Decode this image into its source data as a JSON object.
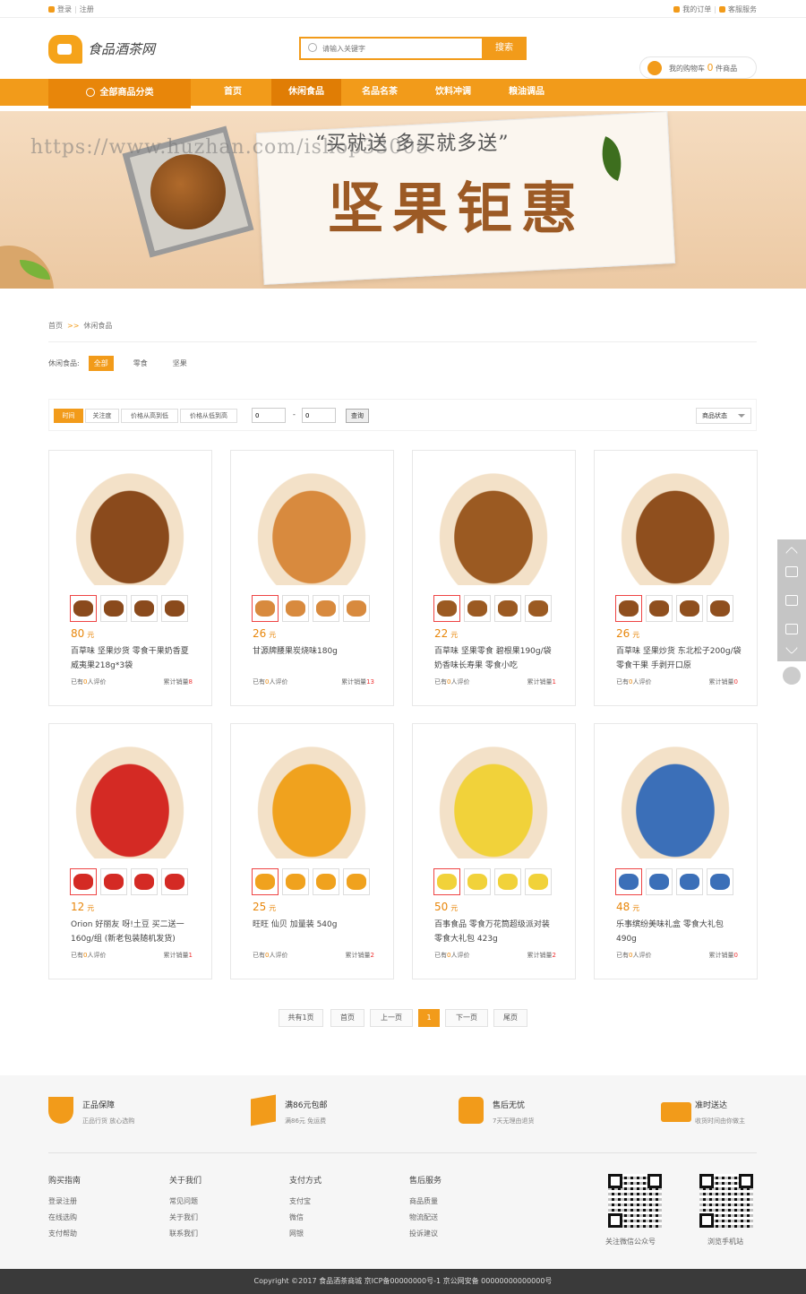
{
  "topbar": {
    "login": "登录",
    "register": "注册",
    "orders": "我的订单",
    "service": "客服服务"
  },
  "header": {
    "logo_text": "食品酒茶网",
    "search_placeholder": "请输入关键字",
    "search_button": "搜索",
    "cart_prefix": "我的购物车",
    "cart_count": "0",
    "cart_suffix": "件商品"
  },
  "nav": {
    "all": "全部商品分类",
    "items": [
      "首页",
      "休闲食品",
      "名品名茶",
      "饮料冲调",
      "粮油调品"
    ],
    "active": 1
  },
  "banner": {
    "watermark": "https://www.huzhan.com/ishop33008",
    "subtitle": "“买就送 多买就多送”",
    "title": "坚果钜惠"
  },
  "breadcrumb": {
    "home": "首页",
    "sep": ">>",
    "current": "休闲食品"
  },
  "filter": {
    "label": "休闲食品:",
    "options": [
      "全部",
      "零食",
      "坚果"
    ]
  },
  "sort": {
    "buttons": [
      "时间",
      "关注度",
      "价格从高到低",
      "价格从低到高"
    ],
    "min": "0",
    "max": "0",
    "query": "查询",
    "status": "商品状态"
  },
  "products": [
    {
      "price": "80",
      "unit": "元",
      "name": "百草味 坚果炒货 零食干果奶香夏威夷果218g*3袋",
      "reviews": "0",
      "sales": "8",
      "color": "#8a4a1c"
    },
    {
      "price": "26",
      "unit": "元",
      "name": "甘源牌腰果炭烧味180g",
      "reviews": "0",
      "sales": "13",
      "color": "#d88a3e"
    },
    {
      "price": "22",
      "unit": "元",
      "name": "百草味 坚果零食 碧根果190g/袋 奶香味长寿果 零食小吃",
      "reviews": "0",
      "sales": "1",
      "color": "#9b5a22"
    },
    {
      "price": "26",
      "unit": "元",
      "name": "百草味 坚果炒货 东北松子200g/袋 零食干果 手剥开口原",
      "reviews": "0",
      "sales": "0",
      "color": "#8f4f1e"
    },
    {
      "price": "12",
      "unit": "元",
      "name": "Orion 好丽友 呀!土豆 买二送一160g/组 (新老包装随机发货)",
      "reviews": "0",
      "sales": "1",
      "color": "#d42a24"
    },
    {
      "price": "25",
      "unit": "元",
      "name": "旺旺 仙贝 加量装 540g",
      "reviews": "0",
      "sales": "2",
      "color": "#f0a21e"
    },
    {
      "price": "50",
      "unit": "元",
      "name": "百事食品 零食万花筒超级派对装 零食大礼包 423g",
      "reviews": "0",
      "sales": "2",
      "color": "#f1d23a"
    },
    {
      "price": "48",
      "unit": "元",
      "name": "乐事缤纷美味礼盒 零食大礼包 490g",
      "reviews": "0",
      "sales": "0",
      "color": "#3b6fb8"
    }
  ],
  "meta": {
    "reviews_prefix": "已有",
    "reviews_suffix": "人评价",
    "sales_prefix": "累计销量"
  },
  "pager": {
    "total": "共有1页",
    "first": "首页",
    "prev": "上一页",
    "current": "1",
    "next": "下一页",
    "last": "尾页"
  },
  "services": [
    {
      "title": "正品保障",
      "desc": "正品行货 放心选购"
    },
    {
      "title": "满86元包邮",
      "desc": "满86元 免运费"
    },
    {
      "title": "售后无忧",
      "desc": "7天无理由退货"
    },
    {
      "title": "准时送达",
      "desc": "收货时间由你做主"
    }
  ],
  "footer_cols": [
    {
      "title": "购买指南",
      "links": [
        "登录注册",
        "在线选购",
        "支付帮助"
      ]
    },
    {
      "title": "关于我们",
      "links": [
        "常见问题",
        "关于我们",
        "联系我们"
      ]
    },
    {
      "title": "支付方式",
      "links": [
        "支付宝",
        "微信",
        "网银"
      ]
    },
    {
      "title": "售后服务",
      "links": [
        "商品质量",
        "物流配送",
        "投诉建议"
      ]
    }
  ],
  "qr": {
    "wechat": "关注微信公众号",
    "mobile": "浏览手机站"
  },
  "copyright": "Copyright ©2017 食品酒茶商城 京ICP备00000000号-1 京公网安备 00000000000000号"
}
